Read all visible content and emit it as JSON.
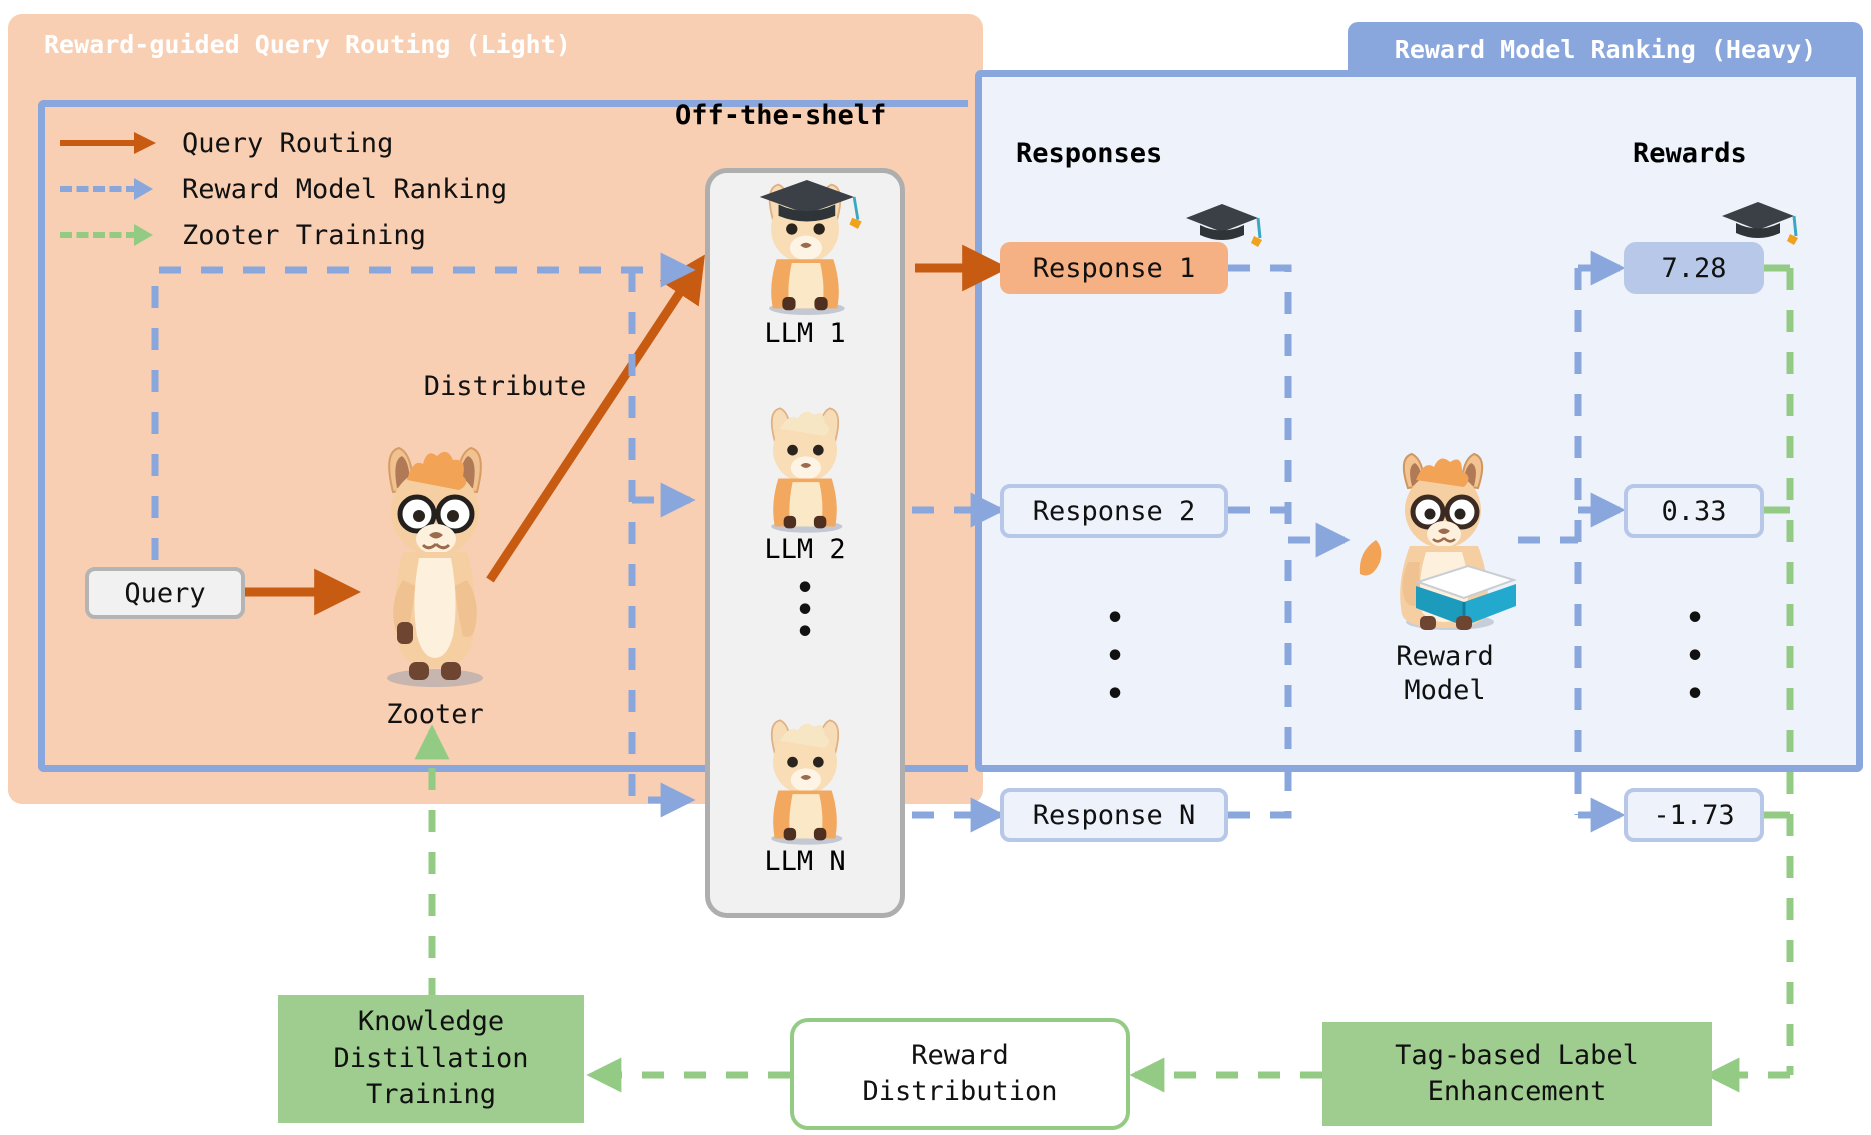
{
  "panels": {
    "light": {
      "title": "Reward-guided Query Routing (Light)",
      "bg": "#f8cfb3"
    },
    "heavy": {
      "title": "Reward Model Ranking (Heavy)",
      "bg": "#edf2fb",
      "border": "#8aa7dd"
    }
  },
  "legend": [
    {
      "label": "Query Routing",
      "style": "solid",
      "color": "#c75b12"
    },
    {
      "label": "Reward Model Ranking",
      "style": "dashed",
      "color": "#8aa7dd"
    },
    {
      "label": "Zooter Training",
      "style": "dashed",
      "color": "#93cb85"
    }
  ],
  "headers": {
    "off_the_shelf": "Off-the-shelf",
    "responses": "Responses",
    "rewards": "Rewards"
  },
  "query": {
    "label": "Query"
  },
  "zooter": {
    "caption": "Zooter"
  },
  "distribute": {
    "label": "Distribute"
  },
  "llms": [
    {
      "label": "LLM 1"
    },
    {
      "label": "LLM 2"
    },
    {
      "label": "LLM N"
    }
  ],
  "llm_ellipsis": "•\n•\n•",
  "responses": [
    {
      "label": "Response 1",
      "highlighted": true
    },
    {
      "label": "Response 2",
      "highlighted": false
    },
    {
      "label": "Response N",
      "highlighted": false
    }
  ],
  "responses_ellipsis": "•\n•\n•",
  "reward_model": {
    "caption": "Reward\nModel"
  },
  "rewards": [
    {
      "value": "7.28",
      "highlighted": true
    },
    {
      "value": "0.33",
      "highlighted": false
    },
    {
      "value": "-1.73",
      "highlighted": false
    }
  ],
  "rewards_ellipsis": "•\n•\n•",
  "bottom": {
    "knowledge_distillation": "Knowledge\nDistillation\nTraining",
    "reward_distribution": "Reward\nDistribution",
    "tag_based": "Tag-based Label\nEnhancement"
  },
  "colors": {
    "orange_accent": "#c75b12",
    "blue_accent": "#8aa7dd",
    "green_accent": "#93cb85",
    "light_panel": "#f8cfb3",
    "heavy_panel": "#edf2fb",
    "green_box": "#9fcc8f",
    "response_highlight": "#f5b183",
    "reward_highlight": "#b8c8e8"
  }
}
